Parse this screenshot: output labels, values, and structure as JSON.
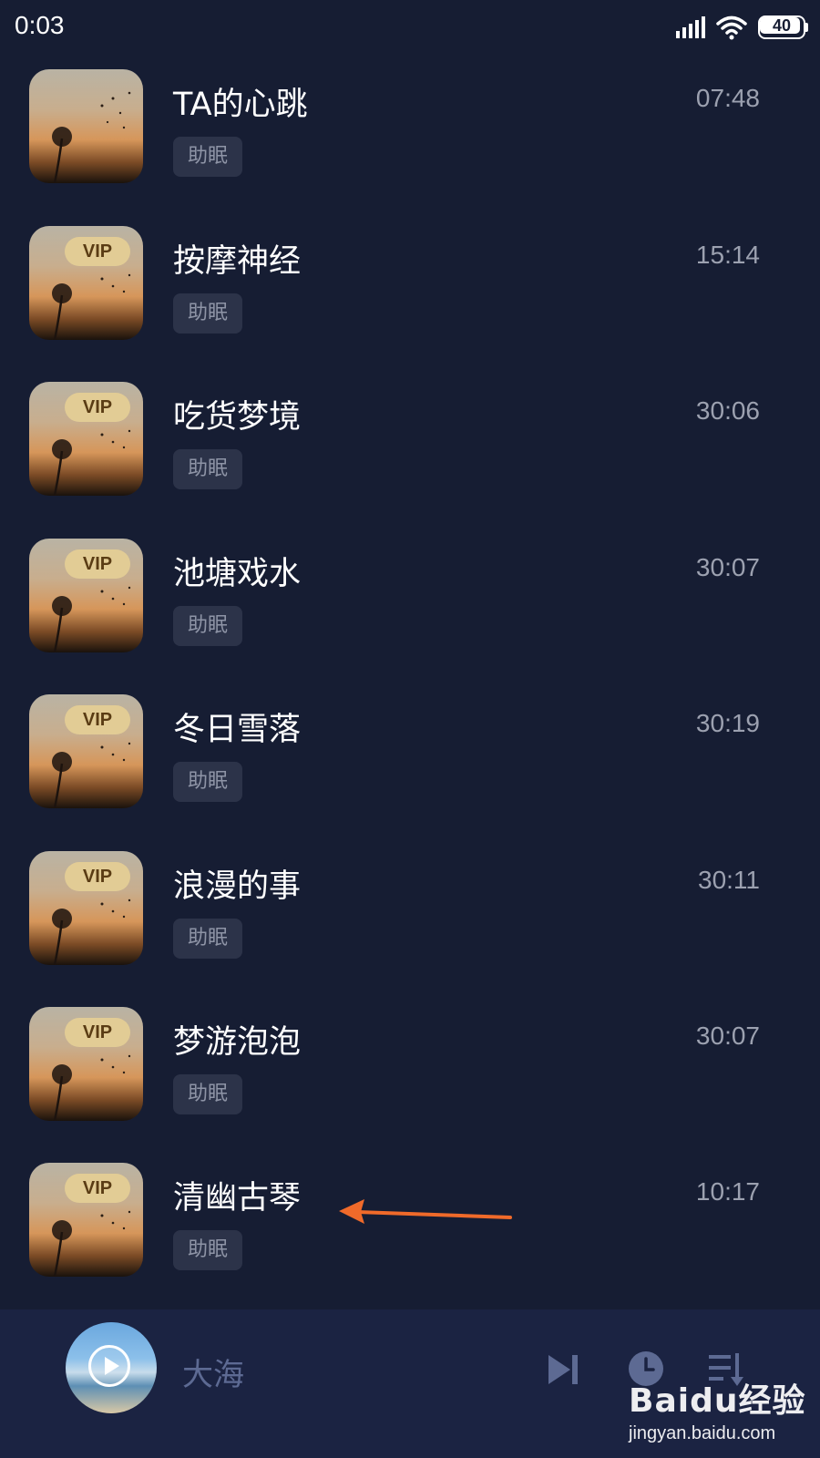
{
  "status_bar": {
    "time": "0:03",
    "battery": "40"
  },
  "tracks": [
    {
      "title": "TA的心跳",
      "tag": "助眠",
      "duration": "07:48",
      "vip": ""
    },
    {
      "title": "按摩神经",
      "tag": "助眠",
      "duration": "15:14",
      "vip": "VIP"
    },
    {
      "title": "吃货梦境",
      "tag": "助眠",
      "duration": "30:06",
      "vip": "VIP"
    },
    {
      "title": "池塘戏水",
      "tag": "助眠",
      "duration": "30:07",
      "vip": "VIP"
    },
    {
      "title": "冬日雪落",
      "tag": "助眠",
      "duration": "30:19",
      "vip": "VIP"
    },
    {
      "title": "浪漫的事",
      "tag": "助眠",
      "duration": "30:11",
      "vip": "VIP"
    },
    {
      "title": "梦游泡泡",
      "tag": "助眠",
      "duration": "30:07",
      "vip": "VIP"
    },
    {
      "title": "清幽古琴",
      "tag": "助眠",
      "duration": "10:17",
      "vip": "VIP"
    }
  ],
  "player": {
    "title": "大海",
    "icons": [
      "play-icon",
      "next-icon",
      "timer-icon",
      "playlist-icon"
    ]
  },
  "watermark": {
    "logo": "Baidu经验",
    "url": "jingyan.baidu.com"
  },
  "colors": {
    "background": "#161d33",
    "player_bar": "#1b2342",
    "vip_badge": "#e2cc95",
    "annotation_arrow": "#f06a2a",
    "player_icons": "#5d6a93"
  }
}
